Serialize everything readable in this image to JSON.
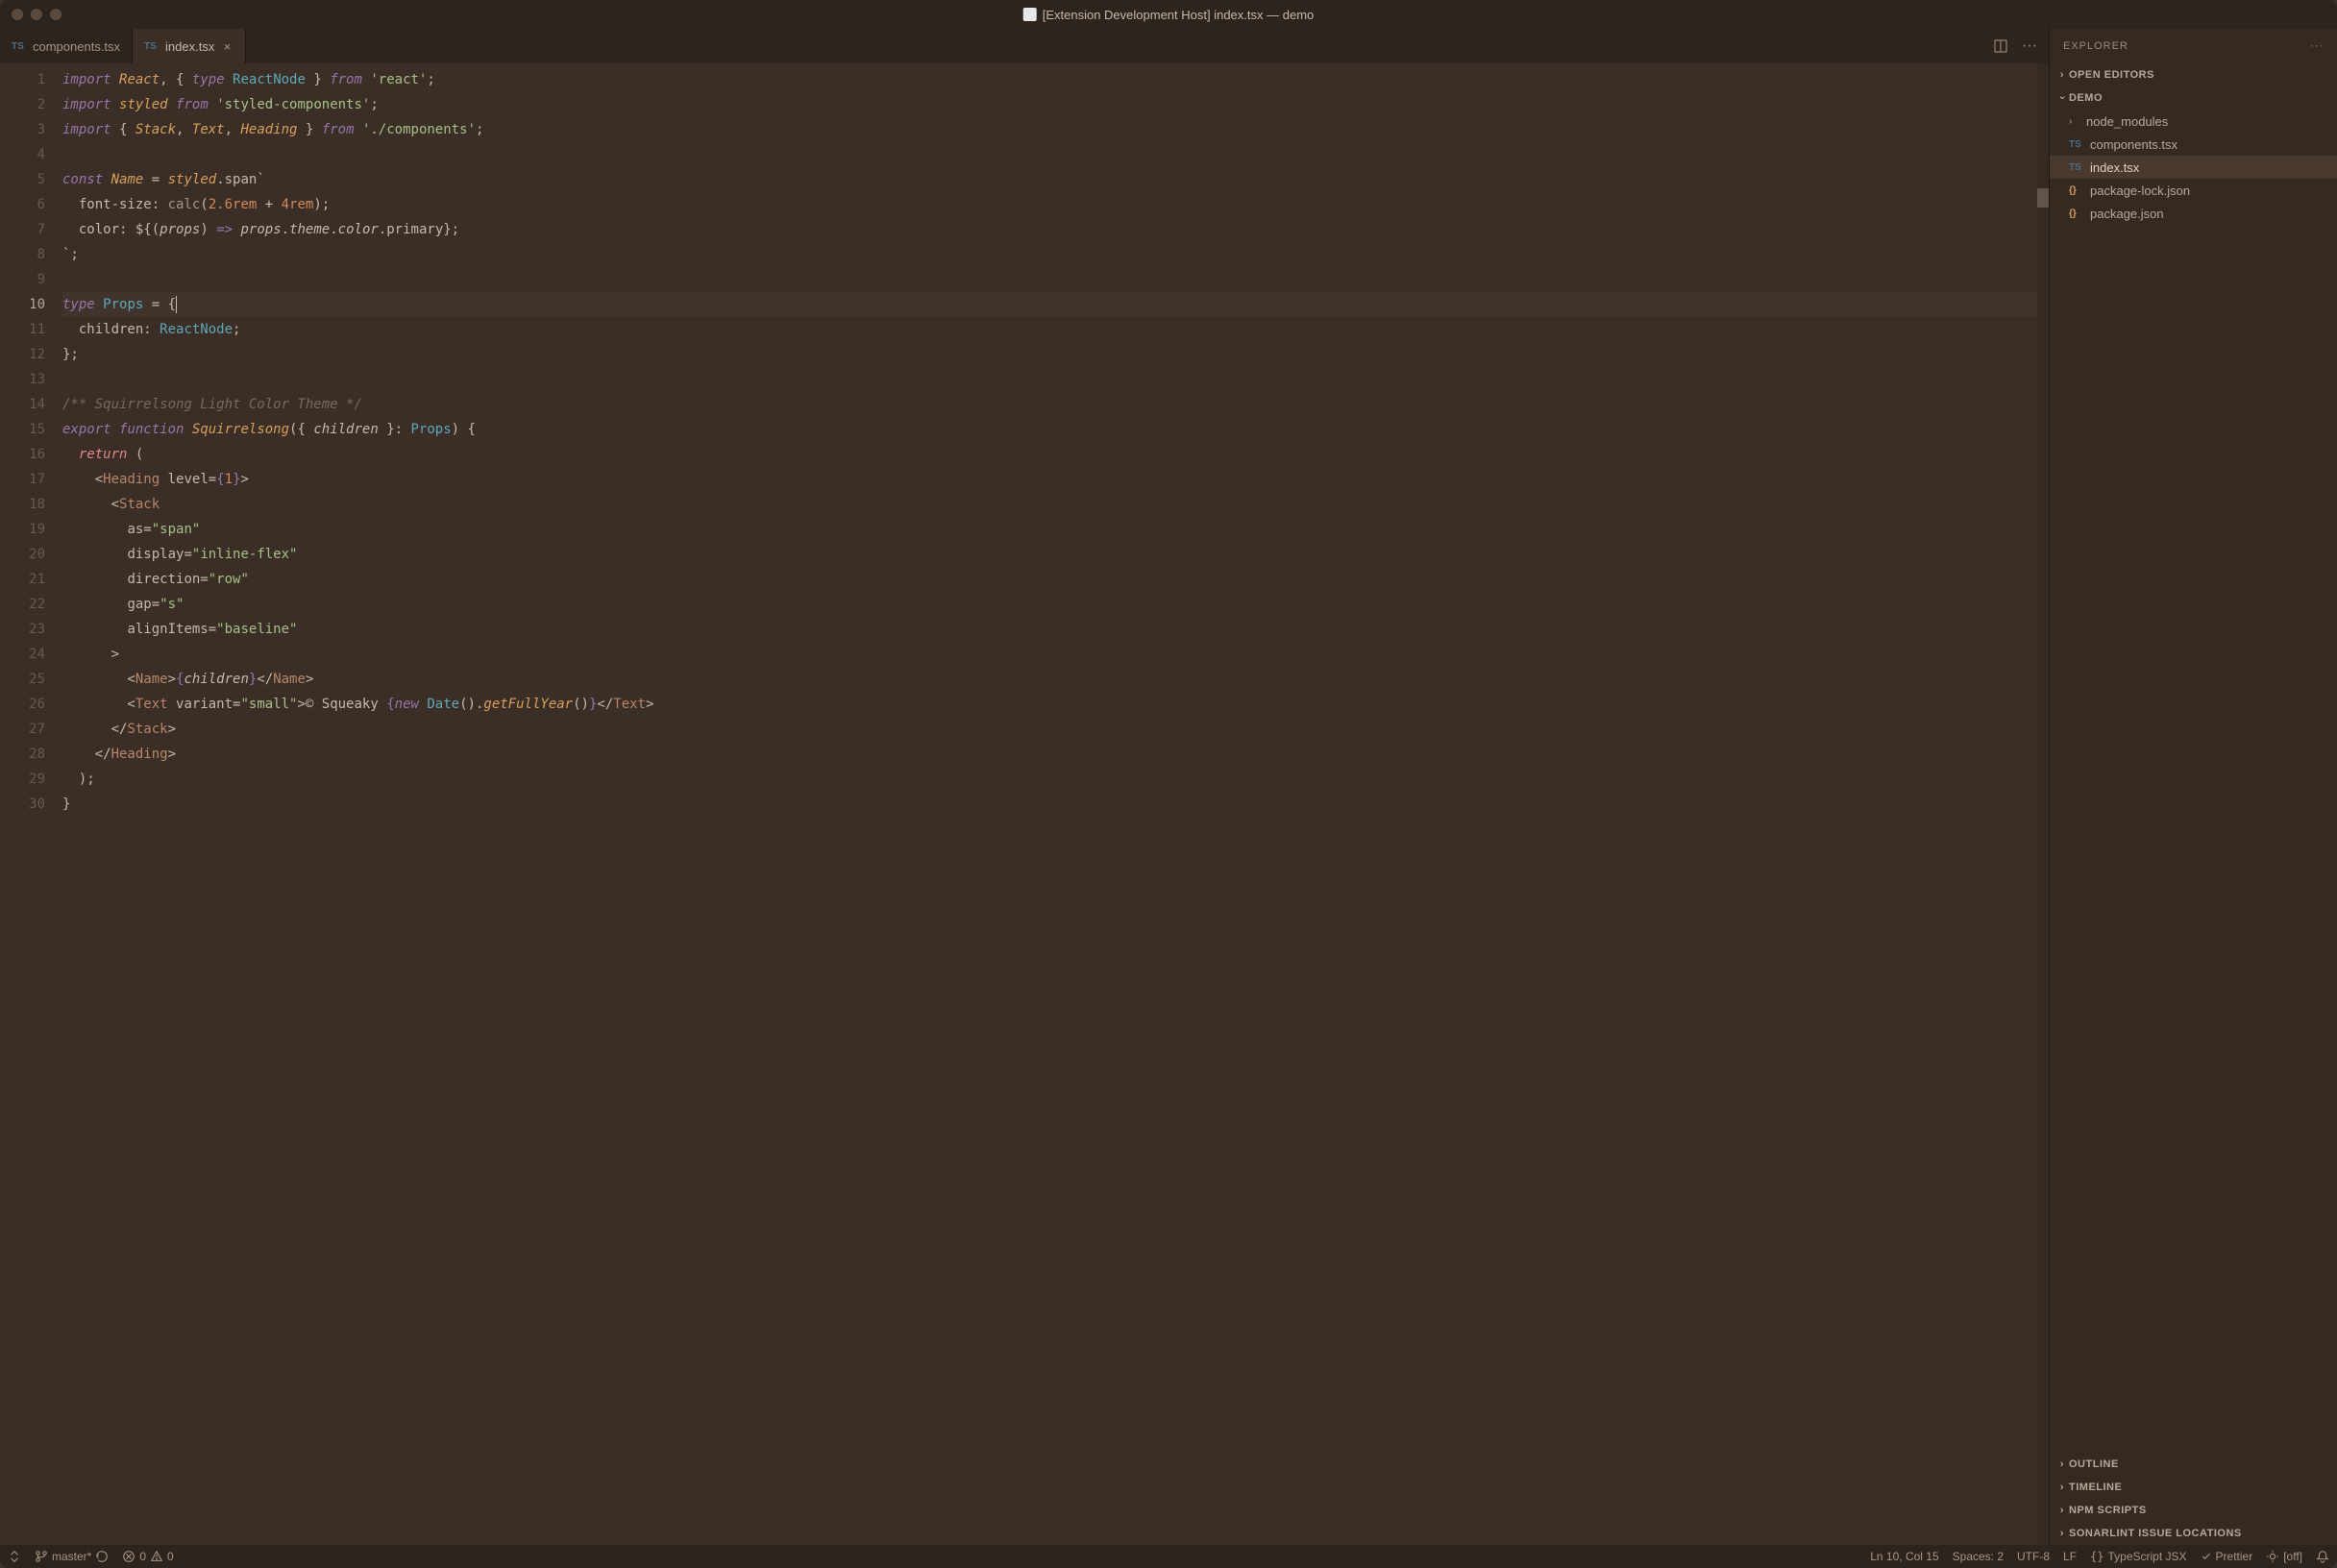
{
  "window": {
    "title": "[Extension Development Host] index.tsx — demo"
  },
  "tabs": [
    {
      "label": "components.tsx",
      "icon": "TS",
      "active": false,
      "closable": false
    },
    {
      "label": "index.tsx",
      "icon": "TS",
      "active": true,
      "closable": true
    }
  ],
  "editor": {
    "line_count": 30,
    "current_line": 10,
    "code_tokens": [
      [
        {
          "c": "kw",
          "t": "import"
        },
        {
          "c": "punc",
          "t": " "
        },
        {
          "c": "id",
          "t": "React"
        },
        {
          "c": "punc",
          "t": ", { "
        },
        {
          "c": "kw",
          "t": "type"
        },
        {
          "c": "punc",
          "t": " "
        },
        {
          "c": "type",
          "t": "ReactNode"
        },
        {
          "c": "punc",
          "t": " } "
        },
        {
          "c": "kw",
          "t": "from"
        },
        {
          "c": "punc",
          "t": " "
        },
        {
          "c": "str",
          "t": "'react'"
        },
        {
          "c": "punc",
          "t": ";"
        }
      ],
      [
        {
          "c": "kw",
          "t": "import"
        },
        {
          "c": "punc",
          "t": " "
        },
        {
          "c": "id",
          "t": "styled"
        },
        {
          "c": "punc",
          "t": " "
        },
        {
          "c": "kw",
          "t": "from"
        },
        {
          "c": "punc",
          "t": " "
        },
        {
          "c": "str",
          "t": "'styled-components'"
        },
        {
          "c": "punc",
          "t": ";"
        }
      ],
      [
        {
          "c": "kw",
          "t": "import"
        },
        {
          "c": "punc",
          "t": " { "
        },
        {
          "c": "id",
          "t": "Stack"
        },
        {
          "c": "punc",
          "t": ", "
        },
        {
          "c": "id",
          "t": "Text"
        },
        {
          "c": "punc",
          "t": ", "
        },
        {
          "c": "id",
          "t": "Heading"
        },
        {
          "c": "punc",
          "t": " } "
        },
        {
          "c": "kw",
          "t": "from"
        },
        {
          "c": "punc",
          "t": " "
        },
        {
          "c": "str",
          "t": "'./components'"
        },
        {
          "c": "punc",
          "t": ";"
        }
      ],
      [],
      [
        {
          "c": "kw",
          "t": "const"
        },
        {
          "c": "punc",
          "t": " "
        },
        {
          "c": "id",
          "t": "Name"
        },
        {
          "c": "punc",
          "t": " = "
        },
        {
          "c": "id",
          "t": "styled"
        },
        {
          "c": "punc",
          "t": ".span`"
        }
      ],
      [
        {
          "c": "punc",
          "t": "  "
        },
        {
          "c": "css-prop",
          "t": "font-size"
        },
        {
          "c": "punc",
          "t": ": "
        },
        {
          "c": "css-fn",
          "t": "calc"
        },
        {
          "c": "punc",
          "t": "("
        },
        {
          "c": "num",
          "t": "2.6rem"
        },
        {
          "c": "punc",
          "t": " + "
        },
        {
          "c": "num",
          "t": "4rem"
        },
        {
          "c": "punc",
          "t": ");"
        }
      ],
      [
        {
          "c": "punc",
          "t": "  "
        },
        {
          "c": "css-prop",
          "t": "color"
        },
        {
          "c": "punc",
          "t": ": ${("
        },
        {
          "c": "param",
          "t": "props"
        },
        {
          "c": "punc",
          "t": ") "
        },
        {
          "c": "kw",
          "t": "=>"
        },
        {
          "c": "punc",
          "t": " "
        },
        {
          "c": "param",
          "t": "props"
        },
        {
          "c": "punc",
          "t": "."
        },
        {
          "c": "param",
          "t": "theme"
        },
        {
          "c": "punc",
          "t": "."
        },
        {
          "c": "param",
          "t": "color"
        },
        {
          "c": "punc",
          "t": ".primary};"
        }
      ],
      [
        {
          "c": "punc",
          "t": "`;"
        }
      ],
      [],
      [
        {
          "c": "kw",
          "t": "type"
        },
        {
          "c": "punc",
          "t": " "
        },
        {
          "c": "type",
          "t": "Props"
        },
        {
          "c": "punc",
          "t": " = {"
        }
      ],
      [
        {
          "c": "punc",
          "t": "  children: "
        },
        {
          "c": "type",
          "t": "ReactNode"
        },
        {
          "c": "punc",
          "t": ";"
        }
      ],
      [
        {
          "c": "punc",
          "t": "};"
        }
      ],
      [],
      [
        {
          "c": "cmt",
          "t": "/** Squirrelsong Light Color Theme */"
        }
      ],
      [
        {
          "c": "kw",
          "t": "export"
        },
        {
          "c": "punc",
          "t": " "
        },
        {
          "c": "kw",
          "t": "function"
        },
        {
          "c": "punc",
          "t": " "
        },
        {
          "c": "id",
          "t": "Squirrelsong"
        },
        {
          "c": "punc",
          "t": "({ "
        },
        {
          "c": "param",
          "t": "children"
        },
        {
          "c": "punc",
          "t": " }: "
        },
        {
          "c": "type",
          "t": "Props"
        },
        {
          "c": "punc",
          "t": ") {"
        }
      ],
      [
        {
          "c": "punc",
          "t": "  "
        },
        {
          "c": "ret",
          "t": "return"
        },
        {
          "c": "punc",
          "t": " ("
        }
      ],
      [
        {
          "c": "punc",
          "t": "    <"
        },
        {
          "c": "tag",
          "t": "Heading"
        },
        {
          "c": "punc",
          "t": " "
        },
        {
          "c": "attr",
          "t": "level"
        },
        {
          "c": "punc",
          "t": "="
        },
        {
          "c": "jsxbrace",
          "t": "{"
        },
        {
          "c": "num",
          "t": "1"
        },
        {
          "c": "jsxbrace",
          "t": "}"
        },
        {
          "c": "punc",
          "t": ">"
        }
      ],
      [
        {
          "c": "punc",
          "t": "      <"
        },
        {
          "c": "tag",
          "t": "Stack"
        }
      ],
      [
        {
          "c": "punc",
          "t": "        "
        },
        {
          "c": "attr",
          "t": "as"
        },
        {
          "c": "punc",
          "t": "="
        },
        {
          "c": "str",
          "t": "\"span\""
        }
      ],
      [
        {
          "c": "punc",
          "t": "        "
        },
        {
          "c": "attr",
          "t": "display"
        },
        {
          "c": "punc",
          "t": "="
        },
        {
          "c": "str",
          "t": "\"inline-flex\""
        }
      ],
      [
        {
          "c": "punc",
          "t": "        "
        },
        {
          "c": "attr",
          "t": "direction"
        },
        {
          "c": "punc",
          "t": "="
        },
        {
          "c": "str",
          "t": "\"row\""
        }
      ],
      [
        {
          "c": "punc",
          "t": "        "
        },
        {
          "c": "attr",
          "t": "gap"
        },
        {
          "c": "punc",
          "t": "="
        },
        {
          "c": "str",
          "t": "\"s\""
        }
      ],
      [
        {
          "c": "punc",
          "t": "        "
        },
        {
          "c": "attr",
          "t": "alignItems"
        },
        {
          "c": "punc",
          "t": "="
        },
        {
          "c": "str",
          "t": "\"baseline\""
        }
      ],
      [
        {
          "c": "punc",
          "t": "      >"
        }
      ],
      [
        {
          "c": "punc",
          "t": "        <"
        },
        {
          "c": "tag",
          "t": "Name"
        },
        {
          "c": "punc",
          "t": ">"
        },
        {
          "c": "jsxbrace",
          "t": "{"
        },
        {
          "c": "param",
          "t": "children"
        },
        {
          "c": "jsxbrace",
          "t": "}"
        },
        {
          "c": "punc",
          "t": "</"
        },
        {
          "c": "tag",
          "t": "Name"
        },
        {
          "c": "punc",
          "t": ">"
        }
      ],
      [
        {
          "c": "punc",
          "t": "        <"
        },
        {
          "c": "tag",
          "t": "Text"
        },
        {
          "c": "punc",
          "t": " "
        },
        {
          "c": "attr",
          "t": "variant"
        },
        {
          "c": "punc",
          "t": "="
        },
        {
          "c": "str",
          "t": "\"small\""
        },
        {
          "c": "punc",
          "t": ">© Squeaky "
        },
        {
          "c": "jsxbrace",
          "t": "{"
        },
        {
          "c": "kw",
          "t": "new"
        },
        {
          "c": "punc",
          "t": " "
        },
        {
          "c": "type",
          "t": "Date"
        },
        {
          "c": "punc",
          "t": "()."
        },
        {
          "c": "id",
          "t": "getFullYear"
        },
        {
          "c": "punc",
          "t": "()"
        },
        {
          "c": "jsxbrace",
          "t": "}"
        },
        {
          "c": "punc",
          "t": "</"
        },
        {
          "c": "tag",
          "t": "Text"
        },
        {
          "c": "punc",
          "t": ">"
        }
      ],
      [
        {
          "c": "punc",
          "t": "      </"
        },
        {
          "c": "tag",
          "t": "Stack"
        },
        {
          "c": "punc",
          "t": ">"
        }
      ],
      [
        {
          "c": "punc",
          "t": "    </"
        },
        {
          "c": "tag",
          "t": "Heading"
        },
        {
          "c": "punc",
          "t": ">"
        }
      ],
      [
        {
          "c": "punc",
          "t": "  );"
        }
      ],
      [
        {
          "c": "punc",
          "t": "}"
        }
      ]
    ]
  },
  "sidebar": {
    "title": "EXPLORER",
    "sections": {
      "open_editors": "OPEN EDITORS",
      "project": "DEMO",
      "outline": "OUTLINE",
      "timeline": "TIMELINE",
      "npm": "NPM SCRIPTS",
      "sonarlint": "SONARLINT ISSUE LOCATIONS"
    },
    "tree": [
      {
        "label": "node_modules",
        "type": "folder",
        "selected": false
      },
      {
        "label": "components.tsx",
        "type": "ts",
        "selected": false
      },
      {
        "label": "index.tsx",
        "type": "ts",
        "selected": true
      },
      {
        "label": "package-lock.json",
        "type": "json",
        "selected": false
      },
      {
        "label": "package.json",
        "type": "json",
        "selected": false
      }
    ]
  },
  "status": {
    "remote": "",
    "branch": "master*",
    "errors": "0",
    "warnings": "0",
    "cursor": "Ln 10, Col 15",
    "spaces": "Spaces: 2",
    "encoding": "UTF-8",
    "eol": "LF",
    "language": "TypeScript JSX",
    "prettier": "Prettier",
    "screencast": "[off]"
  }
}
